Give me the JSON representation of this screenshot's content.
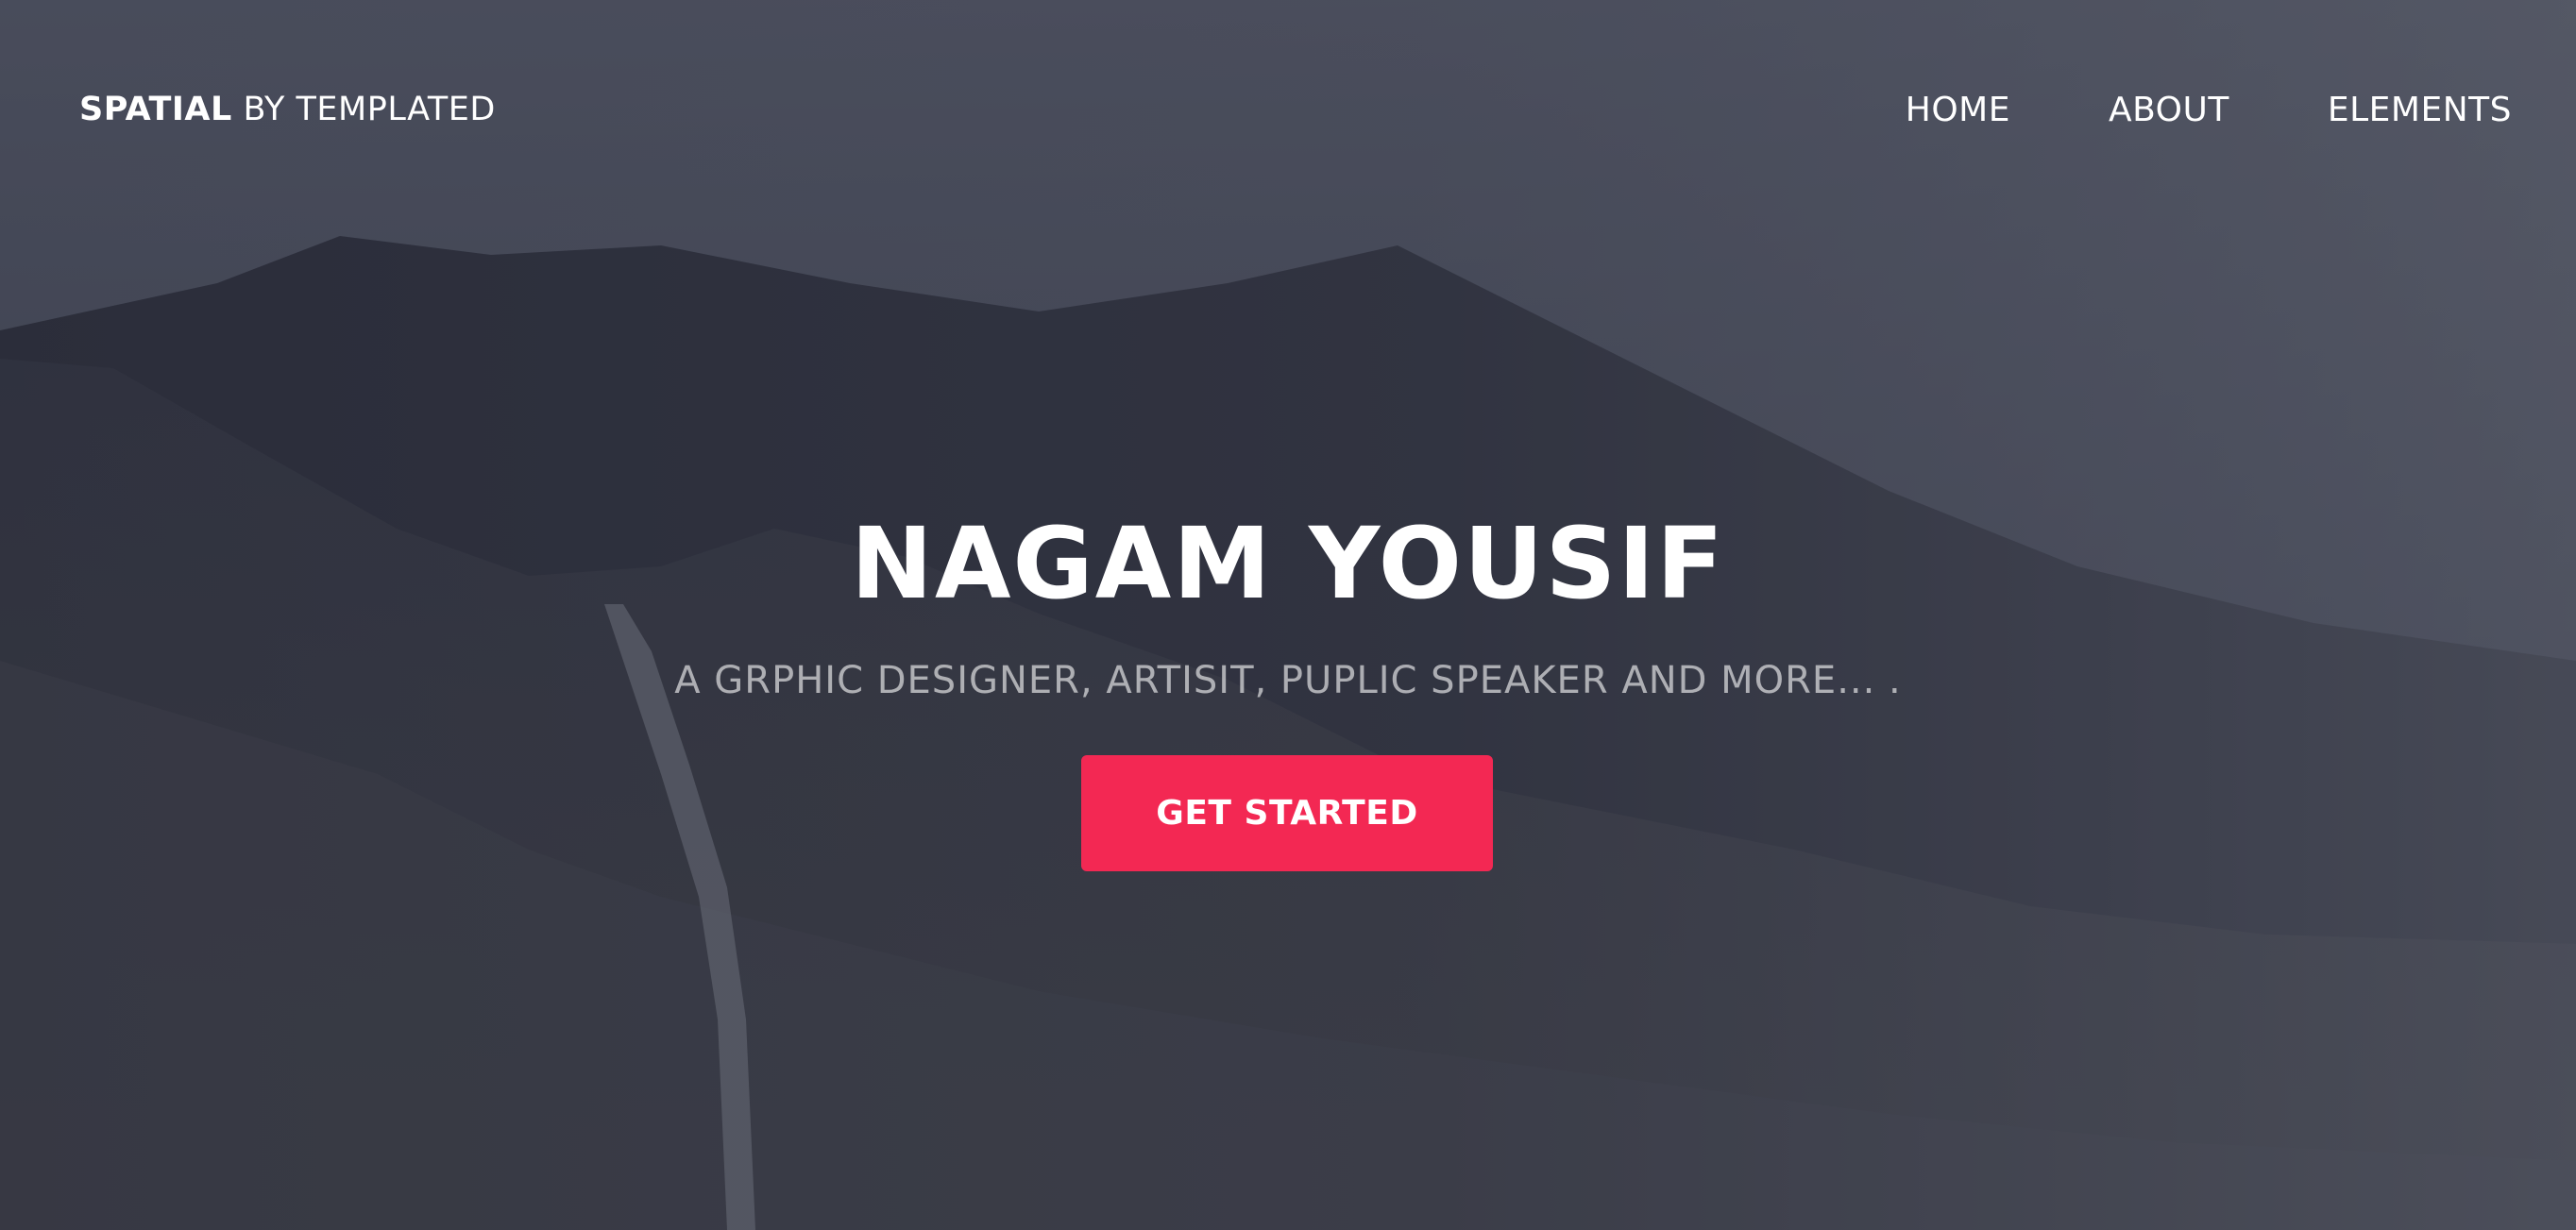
{
  "header": {
    "logo_strong": "SPATIAL",
    "logo_light": "BY TEMPLATED",
    "nav": [
      {
        "label": "HOME"
      },
      {
        "label": "ABOUT"
      },
      {
        "label": "ELEMENTS"
      }
    ]
  },
  "hero": {
    "title": "NAGAM YOUSIF",
    "subtitle": "A GRPHIC DESIGNER, ARTISIT, PUPLIC SPEAKER AND MORE... .",
    "cta_label": "GET STARTED"
  },
  "colors": {
    "accent": "#f32853",
    "text": "#ffffff",
    "subtitle": "#a4a6ad",
    "background": "#34374a"
  }
}
